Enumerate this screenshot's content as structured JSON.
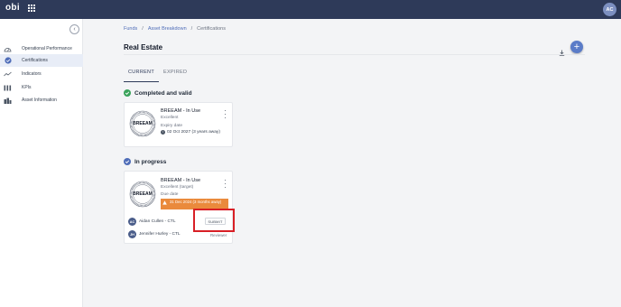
{
  "topbar": {
    "logo": "obi",
    "user_initials": "AC"
  },
  "sidebar": {
    "items": [
      {
        "label": "Operational Performance",
        "icon": "gauge-icon",
        "active": false
      },
      {
        "label": "Certifications",
        "icon": "check-circle-icon",
        "active": true
      },
      {
        "label": "Indicators",
        "icon": "trend-line-icon",
        "active": false
      },
      {
        "label": "KPIs",
        "icon": "bars-icon",
        "active": false
      },
      {
        "label": "Asset Information",
        "icon": "buildings-icon",
        "active": false
      }
    ]
  },
  "breadcrumb": {
    "items": [
      "Funds",
      "Asset Breakdown",
      "Certifications"
    ],
    "separator": "/"
  },
  "page": {
    "title": "Real Estate"
  },
  "tabs": [
    {
      "label": "CURRENT",
      "active": true
    },
    {
      "label": "EXPIRED",
      "active": false
    }
  ],
  "sections": {
    "completed": "Completed and valid",
    "in_progress": "In progress"
  },
  "completed_card": {
    "seal_text": "BREEAM",
    "name": "BREEAM - In Use",
    "rating": "Excellent",
    "expiry_label": "Expiry date",
    "expiry_value": "02 Oct 2027 (3 years away)"
  },
  "progress_card": {
    "seal_text": "BREEAM",
    "name": "BREEAM - In Use",
    "rating": "Excellent (target)",
    "due_label": "Due date",
    "due_value": "31 Dec 2024 (3 months away)",
    "people": [
      {
        "initials": "AC",
        "name": "Aidan Cullen - CTL"
      },
      {
        "initials": "JH",
        "name": "Jennifer Hurley - CTL"
      }
    ],
    "submit_label": "SUBMIT",
    "reviewer_label": "Reviewer"
  },
  "colors": {
    "topbar": "#2e3a59",
    "accent": "#5b7cc8",
    "success": "#3aa35b",
    "warning": "#ea8a3c",
    "highlight": "#d81f26"
  }
}
